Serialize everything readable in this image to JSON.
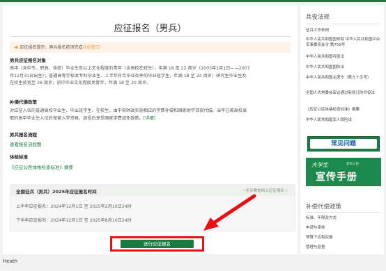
{
  "page_title": "应征报名（男兵）",
  "notice": {
    "text": "应征报名提示：男兵报名前须完成",
    "link": "兵役登记",
    "suffix": "〉"
  },
  "sections": {
    "target_title": "男兵应征报名对象",
    "target_lines": [
      "高中（含中专、职高、技校）毕业生及以上文化程度的青年（含高校在校生），年满 18 至 22 周岁（2003年1月1日——2007",
      "年12月31日出生）；普通高等学校本专科毕业生、上半年符合毕业条件的毕业班学生，年满 18 至 24 周岁；研究生毕业生及",
      "在校生放宽至 26 周岁；初中毕业文化程度男青年，年满 18 至 20 周岁。"
    ],
    "subsidy_title": "补偿代偿政策",
    "subsidy_lines": [
      "对应征入伍的普通高校毕业生、毕业班学生、在校生，由中央财政实施相应的学费补偿和国家助学贷款代偿。当年已被高校录",
      "取的高中毕业生入伍后保留入学资格，退役后享受国家学费减免政策。"
    ],
    "subsidy_link": "[详细]",
    "process_title": "男兵报名流程",
    "process_link": "查看报名流程图",
    "standard_title": "体检标准",
    "standard_link": "《应征公民体格检查标准》摘要"
  },
  "schedule": {
    "title": "全国征兵（男兵）2025年应征报名时间",
    "more": "一步步教你网上应征报名 〉",
    "rows": [
      "上半年应征报名：2024年12月1日 至 2025年2月10日24时",
      "下半年应征报名：2024年12月1日 至 2025年8月10日24时"
    ]
  },
  "submit_label": "进行应征报名",
  "sidebar": {
    "laws_title": "兵役法规",
    "laws": [
      "征兵工作条例",
      "中华人民共和国国务院 中华人民共和国中央军事委员会令 第759号",
      "中华人民共和国兵役法",
      "中华人民共和国国防法",
      "中华人民共和国主席令（第九十五号）",
      "全国人大常委会审议通过新修订的兵役法",
      "《应征公民体格检查标准》摘要",
      "中华人民共和国军人保险法"
    ],
    "faq_banner": "常见问题",
    "brochure_banner_small": "大学生",
    "brochure_banner_tiny": "参军入伍",
    "brochure_banner_big": "宣传手册",
    "policy_title": "补偿代偿政策",
    "policies": [
      "标准、年限及方式",
      "申请与审核",
      "预算下达和实施",
      "管理与监督"
    ]
  },
  "bottom_text": "Heath"
}
